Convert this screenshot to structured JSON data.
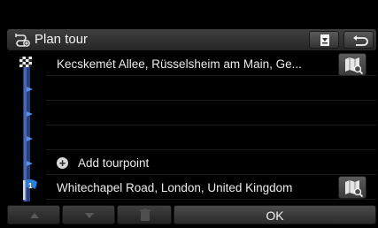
{
  "header": {
    "title": "Plan tour",
    "title_icon": "plan-tour-icon",
    "download_icon": "download-icon",
    "back_icon": "back-arrow-icon"
  },
  "tour": {
    "start": {
      "label": "Kecskemét Allee, Rüsselsheim am Main, Ge...",
      "icon": "checkered-flag-icon",
      "map_icon": "map-search-icon"
    },
    "empty_rows": 2,
    "add_tourpoint_label": "Add tourpoint",
    "add_icon": "plus-circle-icon",
    "destination": {
      "label": "Whitechapel Road, London, United Kingdom",
      "icon": "destination-flag-icon",
      "map_icon": "map-search-icon"
    }
  },
  "footer": {
    "move_up_icon": "triangle-up-icon",
    "move_down_icon": "triangle-down-icon",
    "delete_icon": "trash-icon",
    "ok_label": "OK"
  },
  "colors": {
    "background": "#000000",
    "header": "#333333",
    "route_line": "#2f4f9f",
    "flag_blue": "#2e7fd6"
  }
}
